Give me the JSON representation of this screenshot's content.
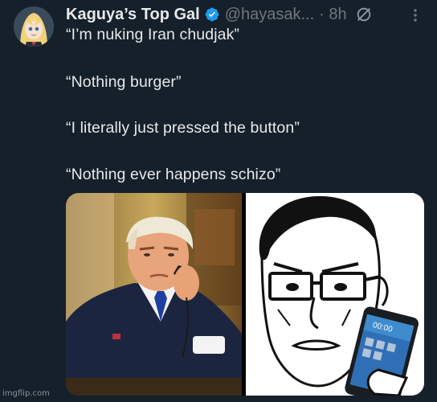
{
  "post": {
    "display_name": "Kaguya’s Top Gal",
    "handle": "@hayasak...",
    "time": "· 8h",
    "verified": true,
    "lines": [
      "“I’m nuking Iran chudjak”",
      "“Nothing burger”",
      "“I literally just pressed the button”",
      "“Nothing ever happens schizo”"
    ]
  },
  "media": {
    "phone_screen_time": "00:00"
  },
  "watermark": "imgflip.com",
  "colors": {
    "background": "#15202b",
    "text": "#e7e9ea",
    "muted": "#71767b",
    "verified": "#1d9bf0"
  }
}
